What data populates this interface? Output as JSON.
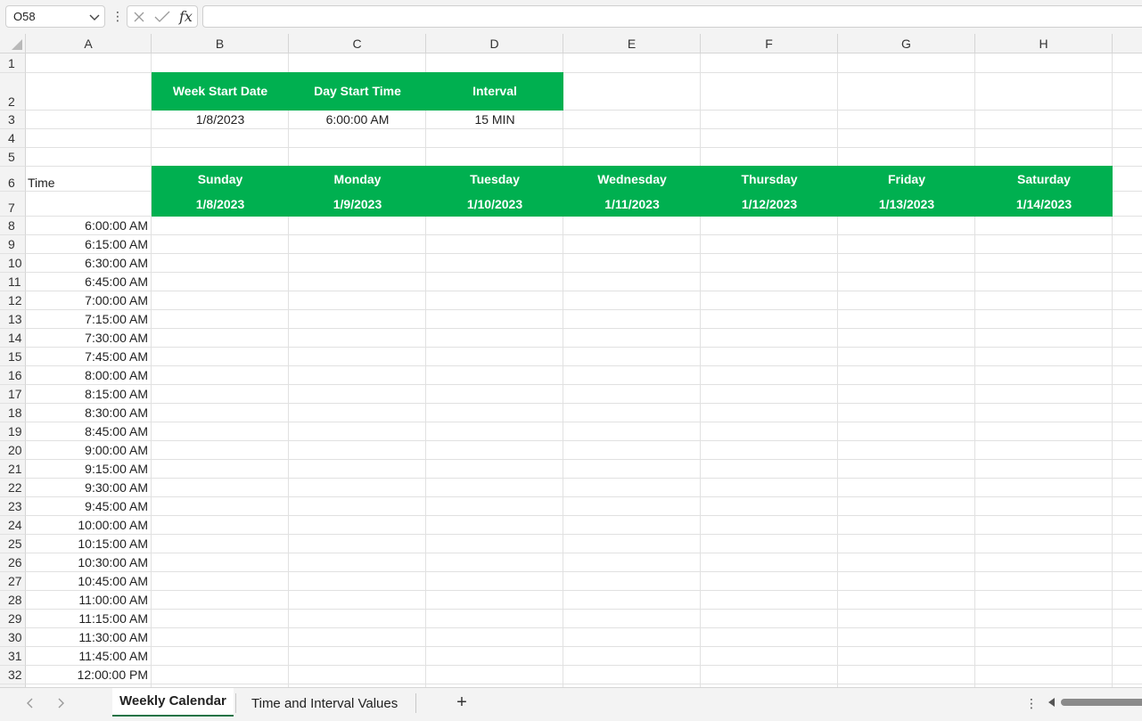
{
  "formula_bar": {
    "name_box": "O58",
    "fx_label": "fx",
    "formula": ""
  },
  "columns": [
    "A",
    "B",
    "C",
    "D",
    "E",
    "F",
    "G",
    "H"
  ],
  "rows": [
    "1",
    "2",
    "3",
    "4",
    "5",
    "6",
    "7",
    "8",
    "9",
    "10",
    "11",
    "12",
    "13",
    "14",
    "15",
    "16",
    "17",
    "18",
    "19",
    "20",
    "21",
    "22",
    "23",
    "24",
    "25",
    "26",
    "27",
    "28",
    "29",
    "30",
    "31",
    "32"
  ],
  "settings": {
    "headers": [
      "Week Start Date",
      "Day Start Time",
      "Interval"
    ],
    "values": [
      "1/8/2023",
      "6:00:00 AM",
      "15 MIN"
    ]
  },
  "time_label": "Time",
  "days": [
    {
      "name": "Sunday",
      "date": "1/8/2023"
    },
    {
      "name": "Monday",
      "date": "1/9/2023"
    },
    {
      "name": "Tuesday",
      "date": "1/10/2023"
    },
    {
      "name": "Wednesday",
      "date": "1/11/2023"
    },
    {
      "name": "Thursday",
      "date": "1/12/2023"
    },
    {
      "name": "Friday",
      "date": "1/13/2023"
    },
    {
      "name": "Saturday",
      "date": "1/14/2023"
    }
  ],
  "times": [
    "6:00:00 AM",
    "6:15:00 AM",
    "6:30:00 AM",
    "6:45:00 AM",
    "7:00:00 AM",
    "7:15:00 AM",
    "7:30:00 AM",
    "7:45:00 AM",
    "8:00:00 AM",
    "8:15:00 AM",
    "8:30:00 AM",
    "8:45:00 AM",
    "9:00:00 AM",
    "9:15:00 AM",
    "9:30:00 AM",
    "9:45:00 AM",
    "10:00:00 AM",
    "10:15:00 AM",
    "10:30:00 AM",
    "10:45:00 AM",
    "11:00:00 AM",
    "11:15:00 AM",
    "11:30:00 AM",
    "11:45:00 AM",
    "12:00:00 PM"
  ],
  "sheet_tabs": [
    "Weekly Calendar",
    "Time and Interval Values"
  ],
  "add_sheet": "+",
  "colors": {
    "header_green": "#00b050",
    "header_text": "#ffffff",
    "active_tab_underline": "#217346"
  }
}
